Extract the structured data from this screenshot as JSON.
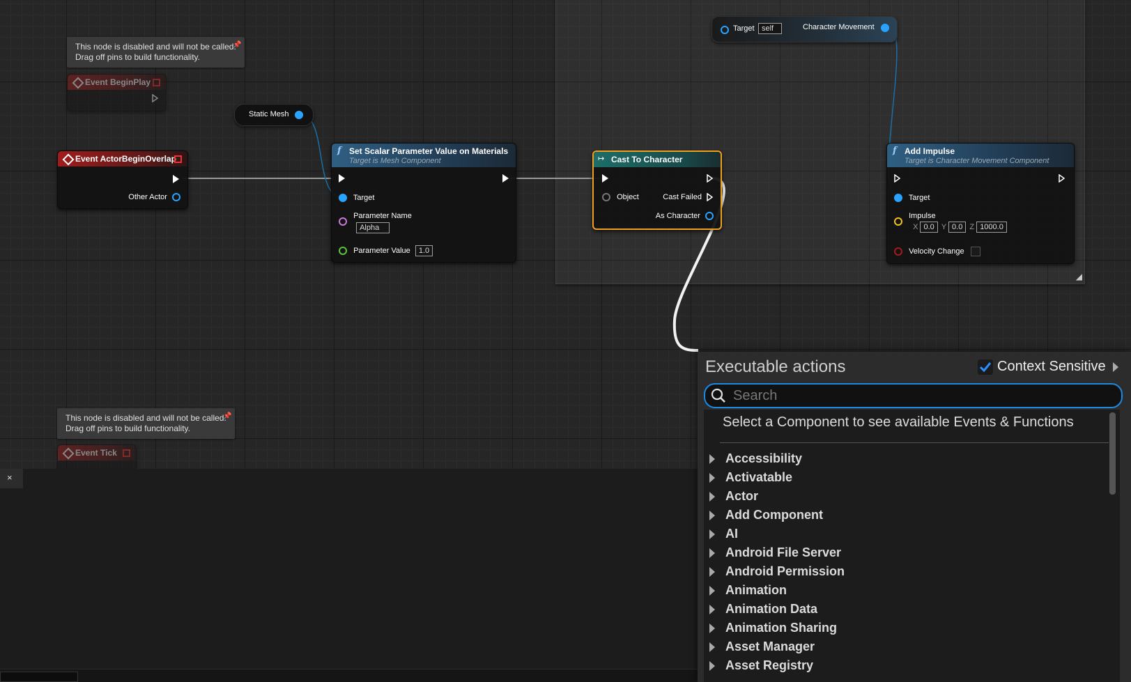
{
  "graph": {
    "tooltip_disabled_1": [
      "This node is disabled and will not be called.",
      "Drag off pins to build functionality."
    ],
    "tooltip_disabled_2": [
      "This node is disabled and will not be called.",
      "Drag off pins to build functionality."
    ],
    "event_begin_play": {
      "title": "Event BeginPlay"
    },
    "event_tick": {
      "title": "Event Tick"
    },
    "event_overlap": {
      "title": "Event ActorBeginOverlap",
      "pin_other_actor": "Other Actor"
    },
    "static_mesh": {
      "title": "Static Mesh"
    },
    "set_scalar": {
      "title": "Set Scalar Parameter Value on Materials",
      "subtitle": "Target is Mesh Component",
      "pin_target": "Target",
      "pin_param_name": "Parameter Name",
      "param_name_value": "Alpha",
      "pin_param_value": "Parameter Value",
      "param_value": "1.0"
    },
    "cast": {
      "title": "Cast To Character",
      "pin_object": "Object",
      "pin_cast_failed": "Cast Failed",
      "pin_as_character": "As Character"
    },
    "char_movement": {
      "target_label": "Target",
      "target_value": "self",
      "output_label": "Character Movement"
    },
    "add_impulse": {
      "title": "Add Impulse",
      "subtitle": "Target is Character Movement Component",
      "pin_target": "Target",
      "pin_impulse": "Impulse",
      "x_label": "X",
      "x_value": "0.0",
      "y_label": "Y",
      "y_value": "0.0",
      "z_label": "Z",
      "z_value": "1000.0",
      "pin_velocity_change": "Velocity Change"
    }
  },
  "panel": {
    "close_label": "×"
  },
  "action_menu": {
    "title": "Executable actions",
    "context_sensitive_label": "Context Sensitive",
    "context_sensitive_checked": true,
    "search_placeholder": "Search",
    "hint": "Select a Component to see available Events & Functions",
    "categories": [
      "Accessibility",
      "Activatable",
      "Actor",
      "Add Component",
      "AI",
      "Android File Server",
      "Android Permission",
      "Animation",
      "Animation Data",
      "Animation Sharing",
      "Asset Manager",
      "Asset Registry"
    ]
  },
  "colors": {
    "exec_wire": "#c8c8c8",
    "object_pin": "#2aa3ff",
    "name_pin": "#c87adf",
    "float_pin": "#5ec63a",
    "vector_pin": "#f2c21a",
    "bool_pin": "#a31c1c",
    "selected_outline": "#f0a020",
    "search_focus": "#1c8ae0",
    "event_header": "#a01c1c",
    "function_header": "#2f5f83",
    "cast_header": "#1d6e6a"
  }
}
